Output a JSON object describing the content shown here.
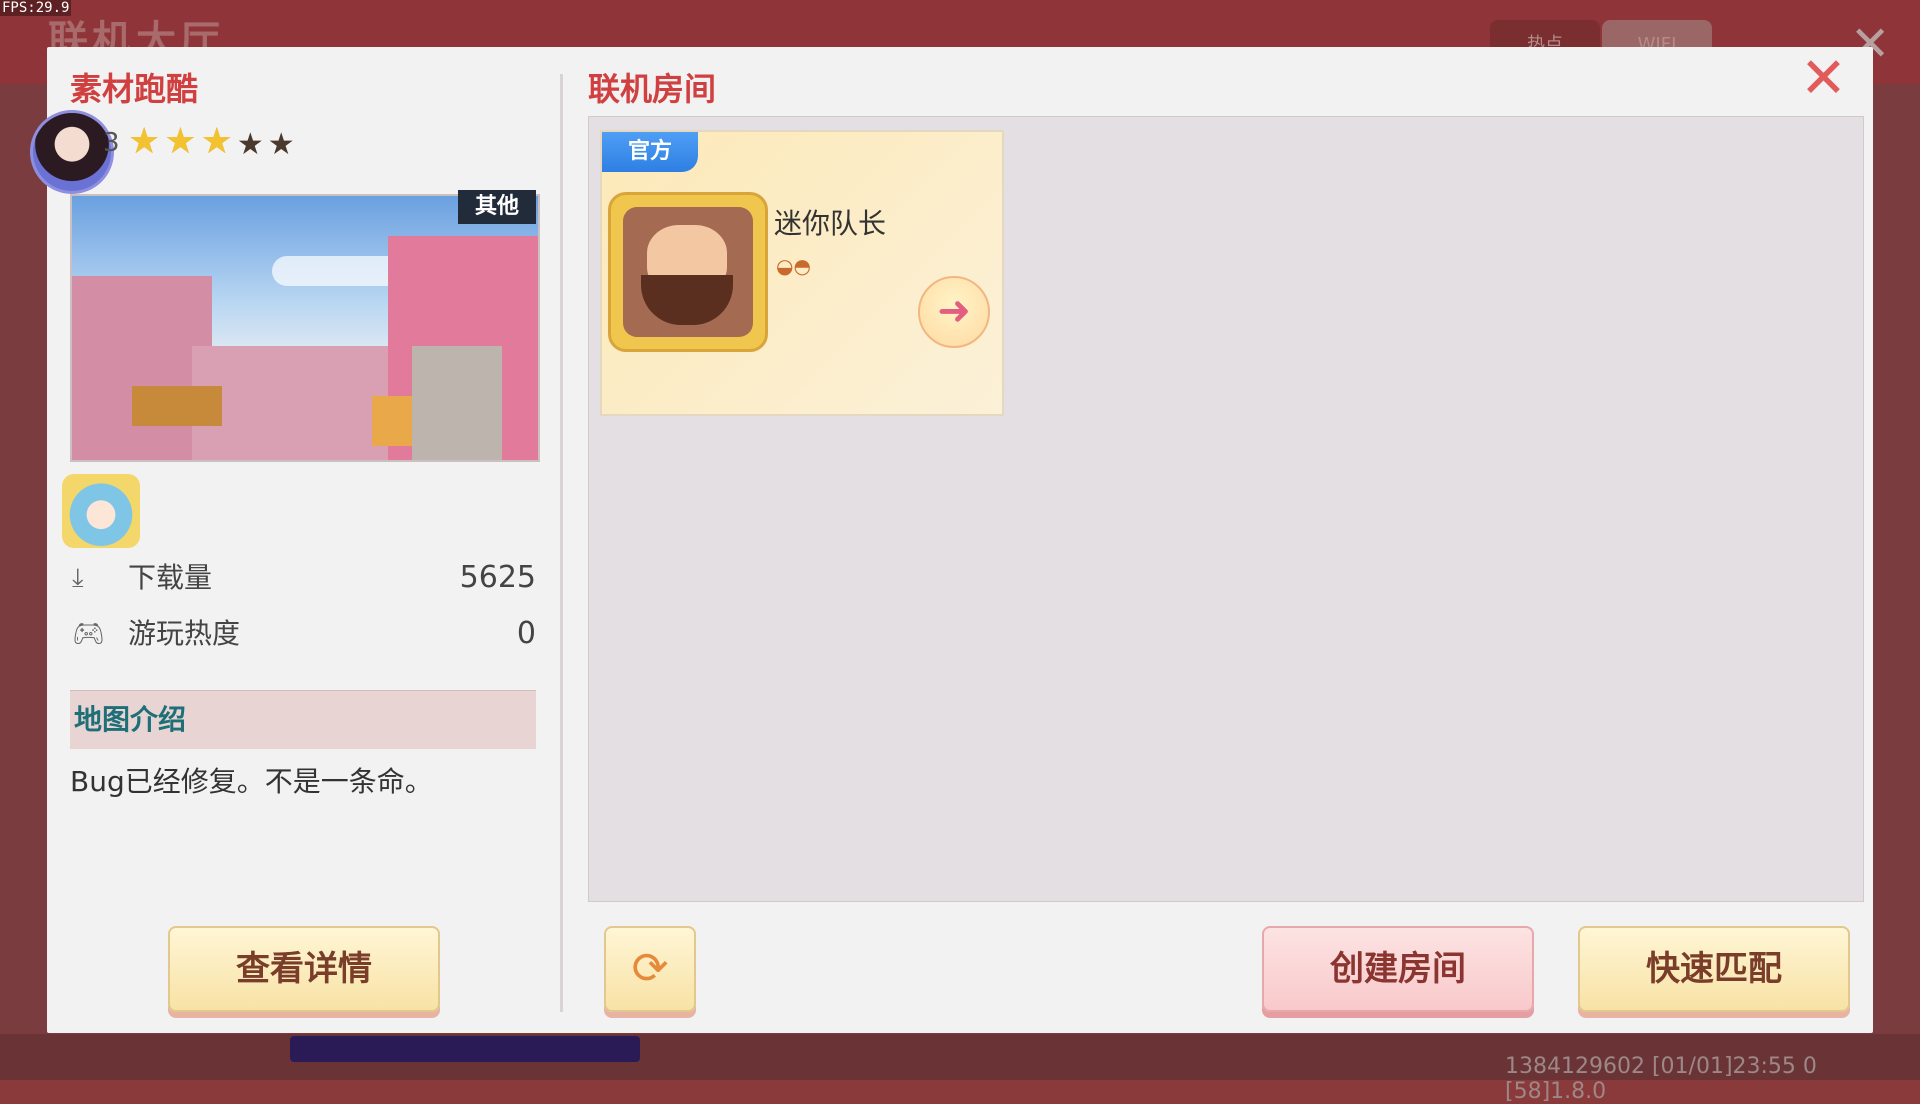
{
  "overlay": {
    "fps": "FPS:29.9",
    "lobby_title": "联机大厅",
    "tabs": [
      "热点",
      "WIFI"
    ],
    "system_info": "1384129602  [01/01]23:55 0  [58]1.8.0"
  },
  "left_panel": {
    "map_title": "素材跑酷",
    "rating": {
      "filled_stars": 3,
      "total_stars": 5,
      "prefix_digit": "3"
    },
    "thumbnail_tag": "其他",
    "stats": [
      {
        "icon": "download-icon",
        "label": "下载量",
        "value": "5625"
      },
      {
        "icon": "gamepad-icon",
        "label": "游玩热度",
        "value": "0"
      }
    ],
    "intro_title": "地图介绍",
    "intro_text": "Bug已经修复。不是一条命。",
    "details_button": "查看详情"
  },
  "right_panel": {
    "title": "联机房间",
    "rooms": [
      {
        "tag": "官方",
        "host_name": "迷你队长",
        "badge_icon": "mask-icon",
        "enter_icon": "arrow-right-icon"
      }
    ],
    "refresh_icon": "refresh-icon",
    "create_button": "创建房间",
    "match_button": "快速匹配"
  },
  "colors": {
    "title_red": "#d04040",
    "intro_teal": "#1e6f78",
    "official_blue": "#2e7fe3",
    "star_gold": "#f2c230"
  }
}
